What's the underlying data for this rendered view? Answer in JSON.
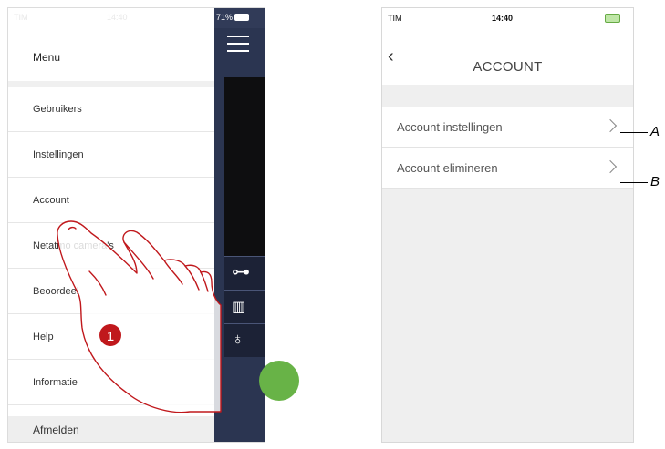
{
  "left_phone": {
    "status": {
      "carrier": "TIM",
      "time": "14:40",
      "battery": "71%"
    },
    "menu": {
      "title": "Menu",
      "items": [
        {
          "label": "Gebruikers"
        },
        {
          "label": "Instellingen"
        },
        {
          "label": "Account"
        },
        {
          "label": "Netatmo camera's"
        },
        {
          "label": "Beoordeel"
        },
        {
          "label": "Help"
        },
        {
          "label": "Informatie"
        }
      ],
      "footer": "Afmelden"
    },
    "step_badge": "1"
  },
  "right_phone": {
    "status": {
      "carrier": "TIM",
      "time": "14:40"
    },
    "title": "ACCOUNT",
    "back_glyph": "‹",
    "rows": [
      {
        "label": "Account instellingen",
        "callout": "A"
      },
      {
        "label": "Account elimineren",
        "callout": "B"
      }
    ]
  },
  "colors": {
    "app_bg": "#2b3551",
    "fab_green": "#68b347",
    "hand_stroke": "#c0181c"
  }
}
